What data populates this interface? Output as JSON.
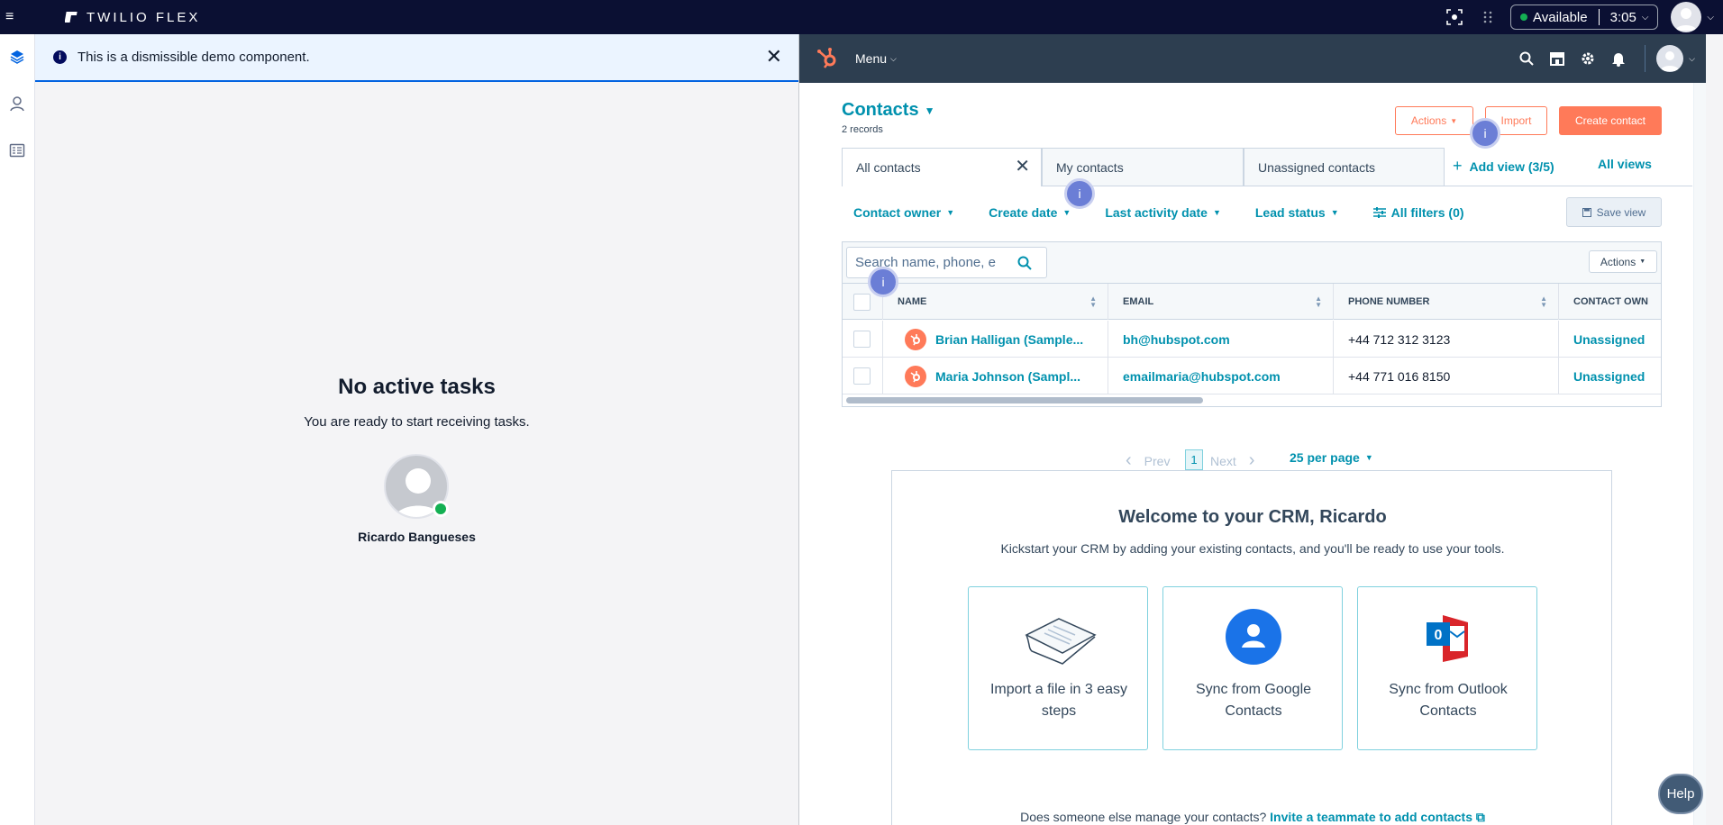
{
  "flex": {
    "brand": "TWILIO FLEX",
    "status": "Available",
    "time": "3:05",
    "banner": "This is a dismissible demo component.",
    "no_tasks_title": "No active tasks",
    "no_tasks_sub": "You are ready to start receiving tasks.",
    "agent_name": "Ricardo Bangueses",
    "help": "Help"
  },
  "hubspot": {
    "menu": "Menu",
    "title": "Contacts",
    "records": "2 records",
    "actions": "Actions",
    "import": "Import",
    "create": "Create contact",
    "info_marker": "i",
    "tabs": [
      {
        "label": "All contacts"
      },
      {
        "label": "My contacts"
      },
      {
        "label": "Unassigned contacts"
      }
    ],
    "add_view": "Add view (3/5)",
    "all_views": "All views",
    "filters": [
      "Contact owner",
      "Create date",
      "Last activity date",
      "Lead status"
    ],
    "all_filters": "All filters (0)",
    "save_view": "Save view",
    "search_placeholder": "Search name, phone, e",
    "table_actions": "Actions",
    "columns": [
      "NAME",
      "EMAIL",
      "PHONE NUMBER",
      "CONTACT OWN"
    ],
    "rows": [
      {
        "name": "Brian Halligan (Sample...",
        "email": "bh@hubspot.com",
        "phone": "+44 712 312 3123",
        "owner": "Unassigned"
      },
      {
        "name": "Maria Johnson (Sampl...",
        "email": "emailmaria@hubspot.com",
        "phone": "+44 771 016 8150",
        "owner": "Unassigned"
      }
    ],
    "pager": {
      "prev": "Prev",
      "current": "1",
      "next": "Next",
      "per_page": "25 per page"
    },
    "welcome": {
      "title": "Welcome to your CRM, Ricardo",
      "subtitle": "Kickstart your CRM by adding your existing contacts, and you'll be ready to use your tools.",
      "cards": [
        {
          "label": "Import a file in 3 easy steps"
        },
        {
          "label": "Sync from Google Contacts"
        },
        {
          "label": "Sync from Outlook Contacts"
        }
      ],
      "footer_text": "Does someone else manage your contacts?",
      "footer_link": "Invite a teammate to add contacts"
    }
  },
  "colors": {
    "flex_nav": "#0b1033",
    "hubspot_nav": "#2d3e50",
    "teal": "#0091ae",
    "orange": "#ff7a59",
    "available": "#14b053"
  }
}
